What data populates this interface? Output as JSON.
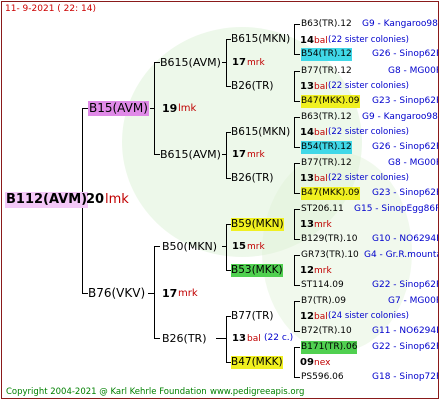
{
  "header": {
    "date": "11-  9-2021 (  22:  14)"
  },
  "footer": {
    "copyright": "Copyright 2004-2021 @ Karl Kehrle Foundation",
    "site": "www.pedigreeapis.org"
  },
  "colors": {
    "border": "#8a1a1a",
    "pink": "#e08ae8",
    "cyan": "#40d8e8",
    "yellow": "#f0f020",
    "green": "#50d050",
    "watermark": "#dff2d8"
  },
  "root": {
    "name": "B112(AVM)",
    "num": "20",
    "mark": "lmk"
  },
  "g1": [
    {
      "name": "B15(AVM)",
      "num": "19",
      "mark": "lmk"
    },
    {
      "name": "B76(VKV)",
      "num": "17",
      "mark": "mrk"
    }
  ],
  "g2": [
    {
      "name": "B615(AVM)",
      "num": "17",
      "mark": "mrk"
    },
    {
      "name": "B615(AVM)",
      "num": "17",
      "mark": "mrk"
    },
    {
      "name": "B50(MKN)",
      "num": "15",
      "mark": "mrk"
    },
    {
      "name": "B26(TR)",
      "num": "13",
      "mark": "bal",
      "note": "(22 c.)"
    }
  ],
  "g3": [
    {
      "name": "B615(MKN)",
      "num": "17",
      "mark": "mrk"
    },
    {
      "name": "B26(TR)"
    },
    {
      "name": "B615(MKN)",
      "num": "17",
      "mark": "mrk"
    },
    {
      "name": "B26(TR)"
    },
    {
      "name": "B59(MKN)",
      "num": "13",
      "mark": "mrk"
    },
    {
      "name": "B53(MKK)",
      "num": "12",
      "mark": "mrk"
    },
    {
      "name": "B77(TR)",
      "num": "12",
      "mark": "bal",
      "note": "(24 sister colonies)"
    },
    {
      "name": "B47(MKK)",
      "num": "09",
      "mark": "nex"
    }
  ],
  "g4": [
    {
      "name": "B63(TR).12",
      "info": "G9 - Kangaroo98R"
    },
    {
      "name": "B54(TR).12",
      "info": "G26 - Sinop62R"
    },
    {
      "name": "B77(TR).12",
      "info": "G8 - MG00R"
    },
    {
      "name": "B47(MKK).09",
      "info": "G23 - Sinop62R"
    },
    {
      "name": "B63(TR).12",
      "info": "G9 - Kangaroo98R"
    },
    {
      "name": "B54(TR).12",
      "info": "G26 - Sinop62R"
    },
    {
      "name": "B77(TR).12",
      "info": "G8 - MG00R"
    },
    {
      "name": "B47(MKK).09",
      "info": "G23 - Sinop62R"
    },
    {
      "name": "ST206.11",
      "info": "G15 - SinopEgg86R"
    },
    {
      "name": "B129(TR).10",
      "info": "G10 - NO6294R"
    },
    {
      "name": "GR73(TR).10",
      "info": "G4 - Gr.R.mounta"
    },
    {
      "name": "ST114.09",
      "info": "G22 - Sinop62R"
    },
    {
      "name": "B7(TR).09",
      "info": "G7 - MG00R"
    },
    {
      "name": "B72(TR).10",
      "info": "G11 - NO6294R"
    },
    {
      "name": "B171(TR).06",
      "info": "G22 - Sinop62R"
    },
    {
      "name": "PS596.06",
      "info": "G18 - Sinop72R"
    }
  ],
  "g4_marks": [
    {
      "num": "14",
      "mark": "bal",
      "note": "(22 sister colonies)"
    },
    {
      "num": "13",
      "mark": "bal",
      "note": "(22 sister colonies)"
    },
    {
      "num": "14",
      "mark": "bal",
      "note": "(22 sister colonies)"
    },
    {
      "num": "13",
      "mark": "bal",
      "note": "(22 sister colonies)"
    }
  ]
}
